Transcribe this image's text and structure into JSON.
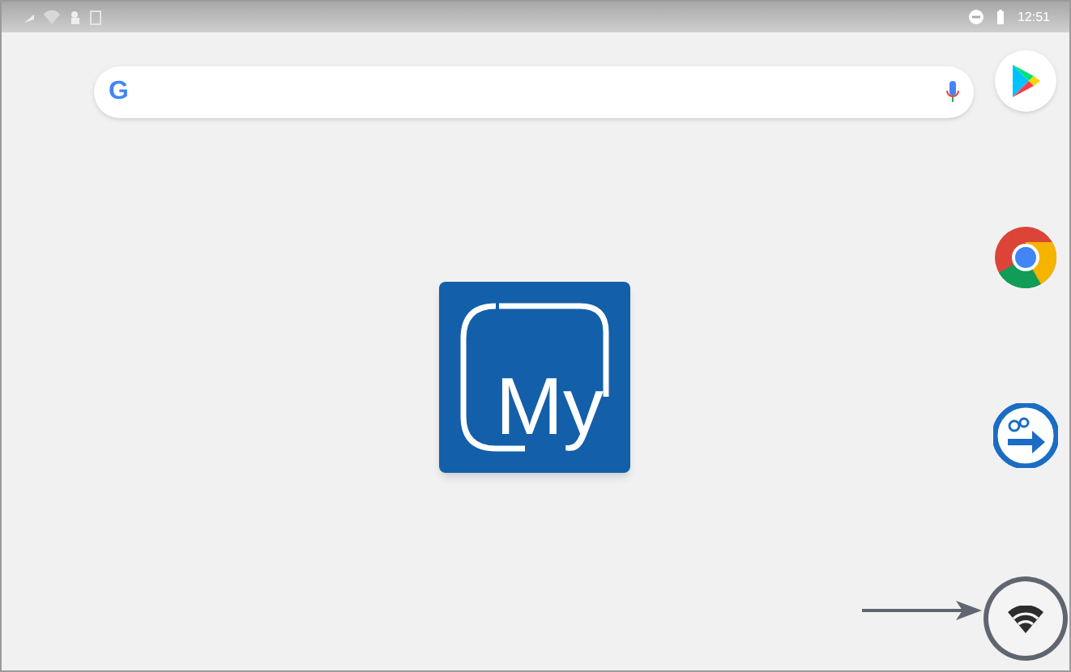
{
  "status_bar": {
    "time": "12:51"
  },
  "search_bar": {
    "logo": "G"
  },
  "home_app": {
    "label": "My"
  },
  "dock": [
    {
      "kind": "play"
    },
    {
      "kind": "chrome"
    },
    {
      "kind": "remote"
    },
    {
      "kind": "wifi",
      "highlighted": true
    }
  ]
}
